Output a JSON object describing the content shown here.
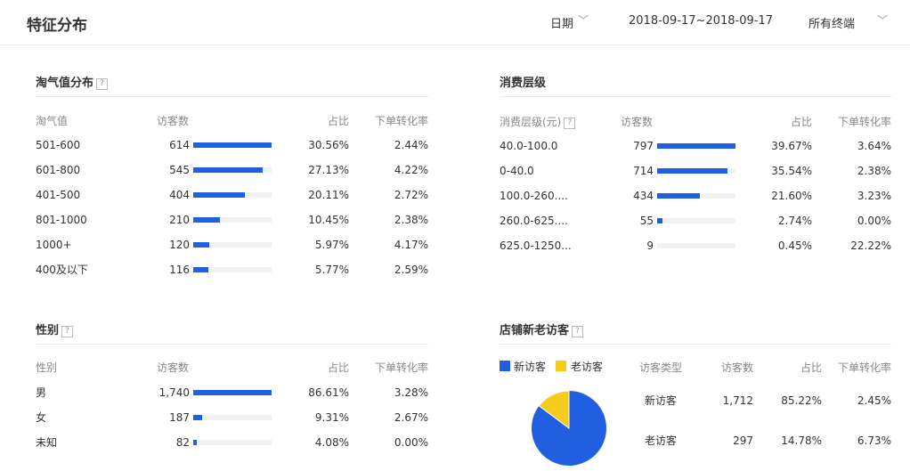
{
  "header": {
    "title": "特征分布",
    "date_label": "日期",
    "date_range": "2018-09-17~2018-09-17",
    "terminal": "所有终端"
  },
  "taoqi": {
    "title": "淘气值分布",
    "columns": [
      "淘气值",
      "访客数",
      "占比",
      "下单转化率"
    ],
    "rows": [
      {
        "label": "501-600",
        "visitors": "614",
        "share": "30.56%",
        "conv": "2.44%",
        "bar": 1.0
      },
      {
        "label": "601-800",
        "visitors": "545",
        "share": "27.13%",
        "conv": "4.22%",
        "bar": 0.89
      },
      {
        "label": "401-500",
        "visitors": "404",
        "share": "20.11%",
        "conv": "2.72%",
        "bar": 0.66
      },
      {
        "label": "801-1000",
        "visitors": "210",
        "share": "10.45%",
        "conv": "2.38%",
        "bar": 0.34
      },
      {
        "label": "1000+",
        "visitors": "120",
        "share": "5.97%",
        "conv": "4.17%",
        "bar": 0.2
      },
      {
        "label": "400及以下",
        "visitors": "116",
        "share": "5.77%",
        "conv": "2.59%",
        "bar": 0.19
      }
    ]
  },
  "consume": {
    "title": "消费层级",
    "columns": [
      "消费层级(元)",
      "访客数",
      "占比",
      "下单转化率"
    ],
    "rows": [
      {
        "label": "40.0-100.0",
        "visitors": "797",
        "share": "39.67%",
        "conv": "3.64%",
        "bar": 1.0
      },
      {
        "label": "0-40.0",
        "visitors": "714",
        "share": "35.54%",
        "conv": "2.38%",
        "bar": 0.9
      },
      {
        "label": "100.0-260....",
        "visitors": "434",
        "share": "21.60%",
        "conv": "3.23%",
        "bar": 0.54
      },
      {
        "label": "260.0-625....",
        "visitors": "55",
        "share": "2.74%",
        "conv": "0.00%",
        "bar": 0.07
      },
      {
        "label": "625.0-1250...",
        "visitors": "9",
        "share": "0.45%",
        "conv": "22.22%",
        "bar": 0.0
      }
    ]
  },
  "gender": {
    "title": "性别",
    "columns": [
      "性别",
      "访客数",
      "占比",
      "下单转化率"
    ],
    "rows": [
      {
        "label": "男",
        "visitors": "1,740",
        "share": "86.61%",
        "conv": "3.28%",
        "bar": 1.0
      },
      {
        "label": "女",
        "visitors": "187",
        "share": "9.31%",
        "conv": "2.67%",
        "bar": 0.11
      },
      {
        "label": "未知",
        "visitors": "82",
        "share": "4.08%",
        "conv": "0.00%",
        "bar": 0.05
      }
    ]
  },
  "newold": {
    "title": "店铺新老访客",
    "legend": [
      {
        "label": "新访客",
        "color": "#1f5fe0"
      },
      {
        "label": "老访客",
        "color": "#f5cc19"
      }
    ],
    "columns": [
      "访客类型",
      "访客数",
      "占比",
      "下单转化率"
    ],
    "rows": [
      {
        "label": "新访客",
        "visitors": "1,712",
        "share": "85.22%",
        "conv": "2.45%"
      },
      {
        "label": "老访客",
        "visitors": "297",
        "share": "14.78%",
        "conv": "6.73%"
      }
    ],
    "pie_new_fraction": 0.8522
  }
}
